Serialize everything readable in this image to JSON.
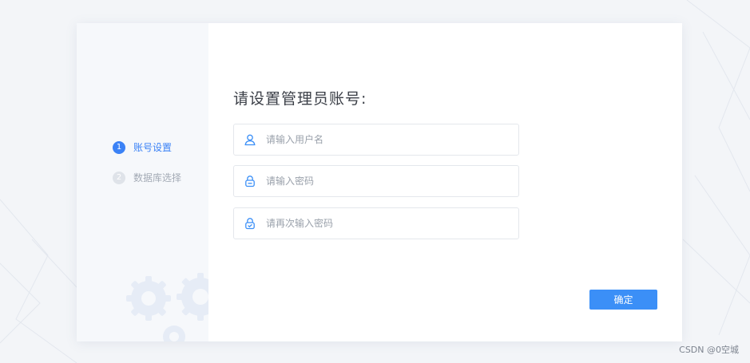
{
  "sidebar": {
    "steps": [
      {
        "number": "1",
        "label": "账号设置",
        "active": true
      },
      {
        "number": "2",
        "label": "数据库选择",
        "active": false
      }
    ]
  },
  "form": {
    "title": "请设置管理员账号:",
    "username": {
      "value": "",
      "placeholder": "请输入用户名",
      "icon": "user-icon"
    },
    "password": {
      "value": "",
      "placeholder": "请输入密码",
      "icon": "lock-icon"
    },
    "confirm_password": {
      "value": "",
      "placeholder": "请再次输入密码",
      "icon": "lock-check-icon"
    },
    "submit_label": "确定"
  },
  "watermark": "CSDN @0空城",
  "colors": {
    "accent": "#3b8ff7",
    "active_step": "#3b82f6",
    "inactive_step": "#a3aab5",
    "page_bg": "#f3f5f8",
    "sidebar_bg": "#f6f8fb"
  }
}
